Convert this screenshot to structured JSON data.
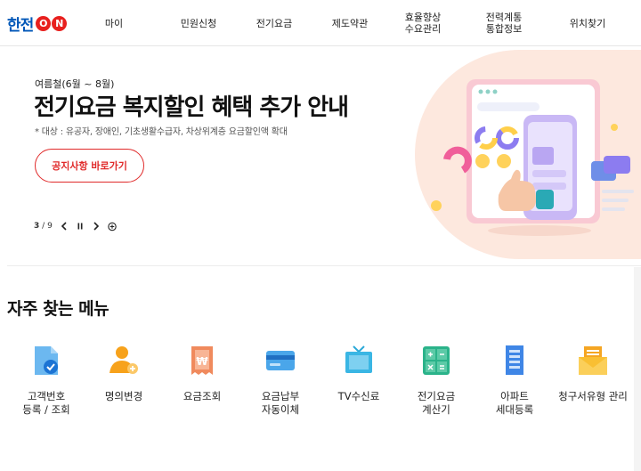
{
  "logo": {
    "text": "한전",
    "on": [
      "O",
      "N"
    ]
  },
  "nav": [
    {
      "label": "마이"
    },
    {
      "label": "민원신청"
    },
    {
      "label": "전기요금"
    },
    {
      "label": "제도약관"
    },
    {
      "label": "효율향상\n수요관리"
    },
    {
      "label": "전력계통\n통합정보"
    },
    {
      "label": "위치찾기"
    }
  ],
  "hero": {
    "period": "여름철(6월 ~ 8월)",
    "title": "전기요금 복지할인 혜택 추가 안내",
    "desc": "* 대상 : 유공자, 장애인, 기초생활수급자, 차상위계층 요금할인액 확대",
    "button": "공지사항 바로가기",
    "pager": {
      "current": "3",
      "separator": "/",
      "total": "9"
    }
  },
  "quick_menu": {
    "title": "자주 찾는 메뉴",
    "items": [
      {
        "label": "고객번호\n등록 / 조회",
        "icon": "customer-number-icon"
      },
      {
        "label": "명의변경",
        "icon": "name-change-icon"
      },
      {
        "label": "요금조회",
        "icon": "bill-inquiry-icon"
      },
      {
        "label": "요금납부\n자동이체",
        "icon": "auto-payment-card-icon"
      },
      {
        "label": "TV수신료",
        "icon": "tv-icon"
      },
      {
        "label": "전기요금\n계산기",
        "icon": "calculator-icon"
      },
      {
        "label": "아파트\n세대등록",
        "icon": "apartment-icon"
      },
      {
        "label": "청구서유형 관리",
        "icon": "bill-envelope-icon"
      }
    ]
  },
  "colors": {
    "brand_blue": "#0057b8",
    "brand_red": "#e8201e",
    "accent_red": "#e02a2a"
  }
}
